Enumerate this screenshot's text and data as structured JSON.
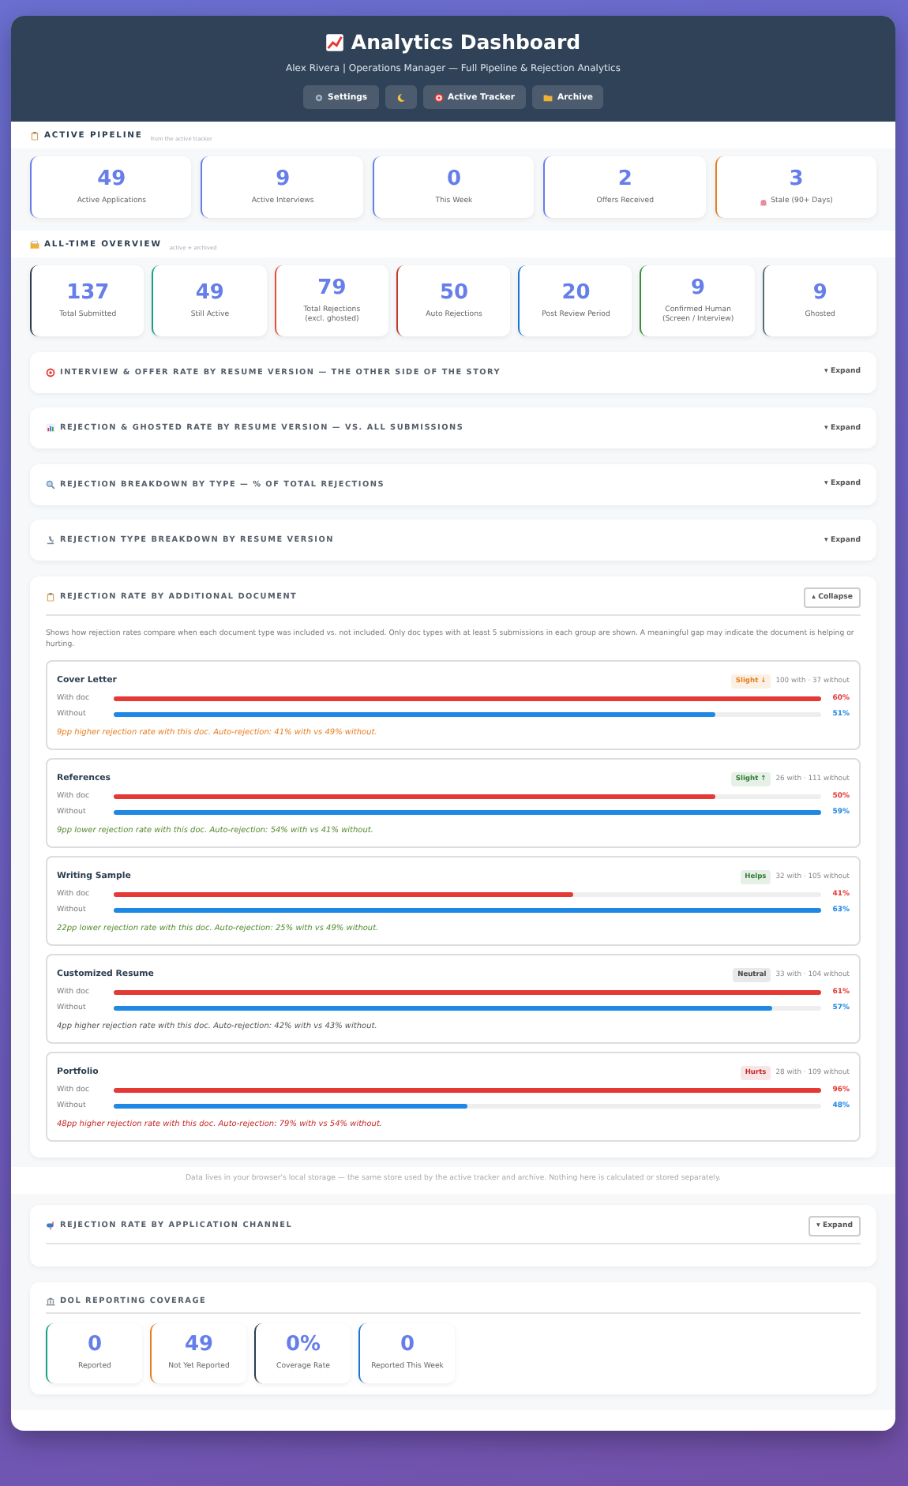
{
  "header": {
    "title": "Analytics Dashboard",
    "subtitle": "Alex Rivera | Operations Manager — Full Pipeline & Rejection Analytics",
    "buttons": [
      {
        "kind": "labeled",
        "label": "Settings"
      },
      {
        "kind": "icon"
      },
      {
        "kind": "labeled",
        "label": "Active Tracker"
      },
      {
        "kind": "labeled",
        "label": "Archive"
      }
    ]
  },
  "pipeline": {
    "title": "ACTIVE PIPELINE",
    "note": "from the active tracker",
    "cards": [
      {
        "kind": "plain",
        "value": "49",
        "label": "Active Applications",
        "color": "#667eea"
      },
      {
        "kind": "plain",
        "value": "9",
        "label": "Active Interviews",
        "color": "#667eea"
      },
      {
        "kind": "plain",
        "value": "0",
        "label": "This Week",
        "color": "#667eea"
      },
      {
        "kind": "plain",
        "value": "2",
        "label": "Offers Received",
        "color": "#667eea"
      },
      {
        "kind": "stale",
        "value": "3",
        "label": "Stale (90+ Days)",
        "color": "#e67e22"
      }
    ]
  },
  "overview": {
    "title": "ALL-TIME OVERVIEW",
    "note": "active + archived",
    "cards": [
      {
        "value": "137",
        "label": "Total Submitted",
        "color": "#2c3e50"
      },
      {
        "value": "49",
        "label": "Still Active",
        "color": "#16a085"
      },
      {
        "value": "79",
        "label": "Total Rejections",
        "sublabel": "(excl. ghosted)",
        "color": "#e74c3c"
      },
      {
        "value": "50",
        "label": "Auto Rejections",
        "color": "#c0392b"
      },
      {
        "value": "20",
        "label": "Post Review Period",
        "color": "#1976d2"
      },
      {
        "value": "9",
        "label": "Confirmed Human",
        "sublabel": "(Screen / Interview)",
        "color": "#388e3c"
      },
      {
        "value": "9",
        "label": "Ghosted",
        "color": "#546e7a"
      }
    ]
  },
  "sections": [
    {
      "kind": "compact",
      "title": "INTERVIEW & OFFER RATE BY RESUME VERSION — THE OTHER SIDE OF THE STORY",
      "toggle": "▾ Expand"
    },
    {
      "kind": "compact",
      "title": "REJECTION & GHOSTED RATE BY RESUME VERSION — VS. ALL SUBMISSIONS",
      "toggle": "▾ Expand"
    },
    {
      "kind": "compact",
      "title": "REJECTION BREAKDOWN BY TYPE — % OF TOTAL REJECTIONS",
      "toggle": "▾ Expand"
    },
    {
      "kind": "compact",
      "title": "REJECTION TYPE BREAKDOWN BY RESUME VERSION",
      "toggle": "▾ Expand"
    },
    {
      "kind": "framed",
      "title": "REJECTION RATE BY ADDITIONAL DOCUMENT",
      "toggle": "▴ Collapse",
      "description": "Shows how rejection rates compare when each document type was included vs. not included. Only doc types with at least 5 submissions in each group are shown. A meaningful gap may indicate the document is helping or hurting.",
      "documents": [
        {
          "name": "Cover Letter",
          "badge": {
            "label": "Slight ↓",
            "color": "#e67e22"
          },
          "counts": "100 with · 37 without",
          "with": {
            "label": "With doc",
            "level": 1,
            "reading": "60%"
          },
          "without": {
            "label": "Without",
            "level": 0.85,
            "reading": "51%"
          },
          "note": {
            "text": "9pp higher rejection rate with this doc. Auto-rejection: 41% with vs 49% without.",
            "color": "#e67e22"
          }
        },
        {
          "name": "References",
          "badge": {
            "label": "Slight ↑",
            "color": "#2e7d32"
          },
          "counts": "26 with · 111 without",
          "with": {
            "label": "With doc",
            "level": 0.85,
            "reading": "50%"
          },
          "without": {
            "label": "Without",
            "level": 1,
            "reading": "59%"
          },
          "note": {
            "text": "9pp lower rejection rate with this doc. Auto-rejection: 54% with vs 41% without.",
            "color": "#558b2f"
          }
        },
        {
          "name": "Writing Sample",
          "badge": {
            "label": "Helps",
            "color": "#2e7d32"
          },
          "counts": "32 with · 105 without",
          "with": {
            "label": "With doc",
            "level": 0.65,
            "reading": "41%"
          },
          "without": {
            "label": "Without",
            "level": 1,
            "reading": "63%"
          },
          "note": {
            "text": "22pp lower rejection rate with this doc. Auto-rejection: 25% with vs 49% without.",
            "color": "#558b2f"
          }
        },
        {
          "name": "Customized Resume",
          "badge": {
            "label": "Neutral",
            "color": "#444444"
          },
          "counts": "33 with · 104 without",
          "with": {
            "label": "With doc",
            "level": 1,
            "reading": "61%"
          },
          "without": {
            "label": "Without",
            "level": 0.93,
            "reading": "57%"
          },
          "note": {
            "text": "4pp higher rejection rate with this doc. Auto-rejection: 42% with vs 43% without.",
            "color": "#555555"
          }
        },
        {
          "name": "Portfolio",
          "badge": {
            "label": "Hurts",
            "color": "#c62828"
          },
          "counts": "28 with · 109 without",
          "with": {
            "label": "With doc",
            "level": 1,
            "reading": "96%"
          },
          "without": {
            "label": "Without",
            "level": 0.5,
            "reading": "48%"
          },
          "note": {
            "text": "48pp higher rejection rate with this doc. Auto-rejection: 79% with vs 54% without.",
            "color": "#c62828"
          }
        }
      ]
    }
  ],
  "footer_note": "Data lives in your browser's local storage — the same store used by the active tracker and archive. Nothing here is calculated or stored separately.",
  "channel": {
    "title": "REJECTION RATE BY APPLICATION CHANNEL",
    "toggle": "▾ Expand"
  },
  "dol": {
    "title": "DOL REPORTING COVERAGE",
    "cards": [
      {
        "value": "0",
        "label": "Reported",
        "color": "#16a085"
      },
      {
        "value": "49",
        "label": "Not Yet Reported",
        "color": "#e67e22"
      },
      {
        "value": "0%",
        "label": "Coverage Rate",
        "color": "#2c3e50"
      },
      {
        "value": "0",
        "label": "Reported This Week",
        "color": "#1976d2"
      }
    ]
  }
}
